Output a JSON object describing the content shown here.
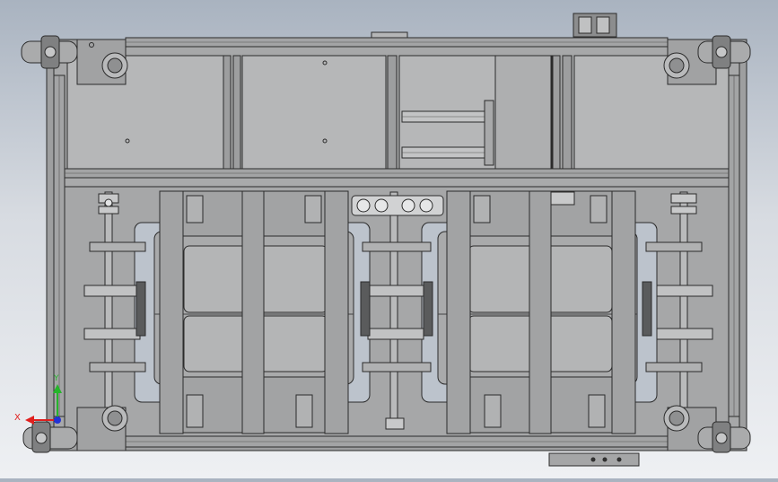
{
  "viewport": {
    "background_top": "#a9b3c0",
    "background_bottom": "#eef0f3",
    "model_color": "#9a9b9c",
    "panel_color": "#b7b8b9",
    "line_color": "#2b2b2b"
  },
  "triad": {
    "x_label": "X",
    "y_label": "Y",
    "x_color": "#e0201e",
    "y_color": "#25b52b",
    "z_color": "#2333d6"
  },
  "components": [
    {
      "name": "caster-wheel",
      "count": 4
    },
    {
      "name": "chain-sprocket-shaft",
      "count": 3
    },
    {
      "name": "tote-bin",
      "count": 2
    },
    {
      "name": "aluminum-frame",
      "count": 1
    }
  ]
}
